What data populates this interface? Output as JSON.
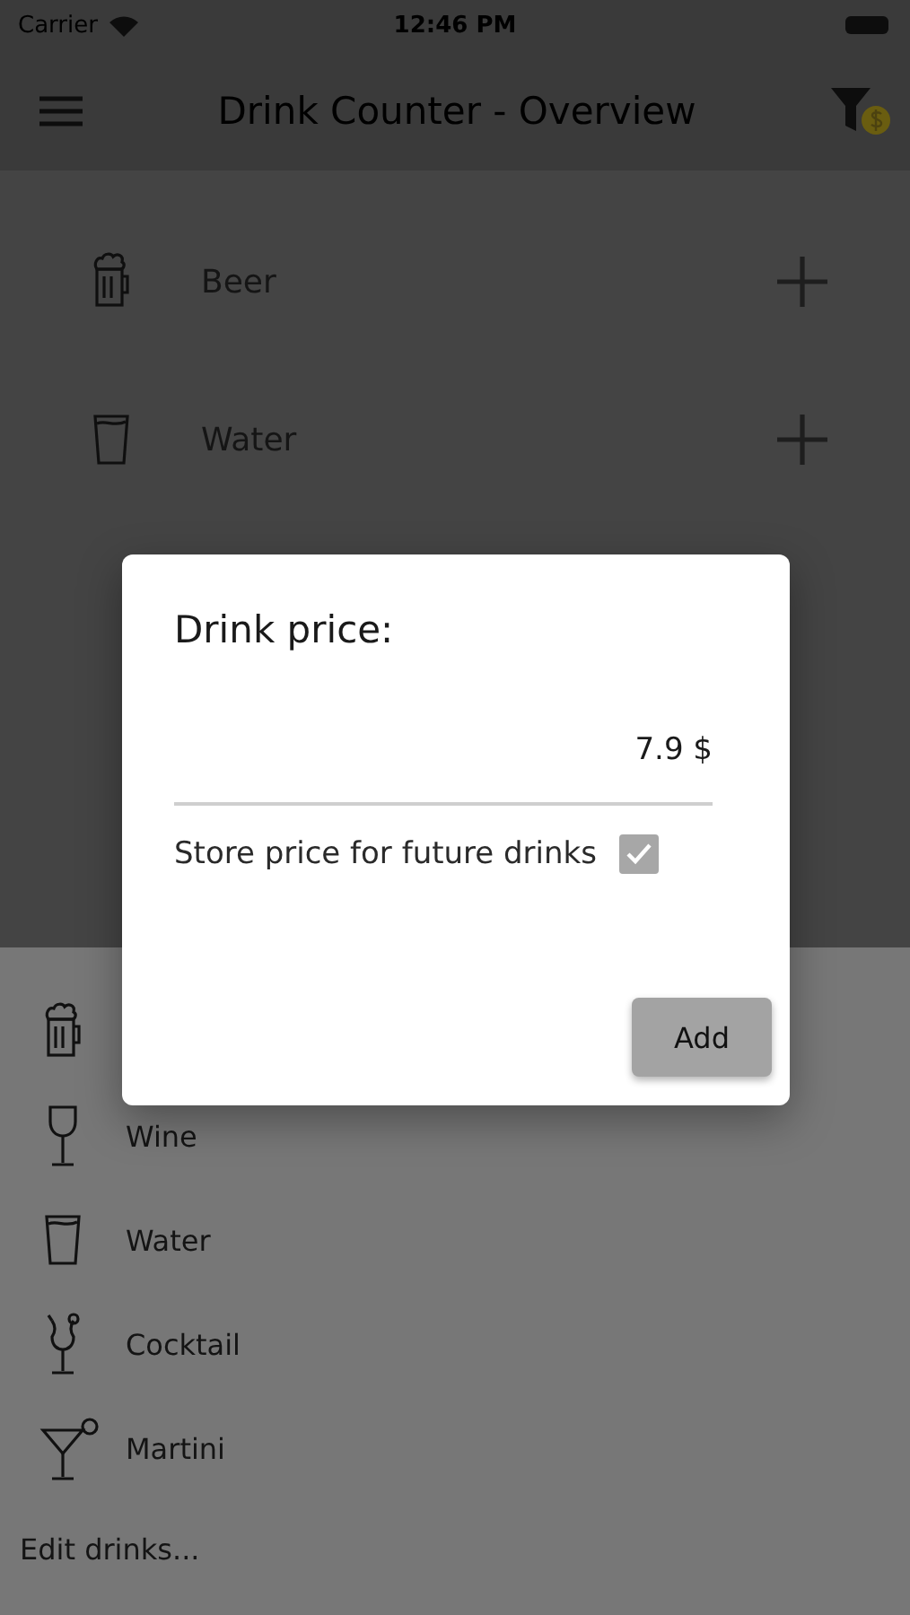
{
  "status_bar": {
    "carrier": "Carrier",
    "time": "12:46 PM"
  },
  "app_bar": {
    "title": "Drink Counter - Overview"
  },
  "counters": [
    {
      "kind": "beer",
      "name": "Beer"
    },
    {
      "kind": "water",
      "name": "Water"
    }
  ],
  "drink_sheet": {
    "items": [
      {
        "kind": "beer"
      },
      {
        "kind": "wine",
        "name": "Wine"
      },
      {
        "kind": "water",
        "name": "Water"
      },
      {
        "kind": "cocktail",
        "name": "Cocktail"
      },
      {
        "kind": "martini",
        "name": "Martini"
      }
    ],
    "edit_link": "Edit drinks..."
  },
  "dialog": {
    "title": "Drink price:",
    "price_value": "7.9 $",
    "store_label": "Store price for future drinks",
    "store_checked": true,
    "button": "Add"
  }
}
